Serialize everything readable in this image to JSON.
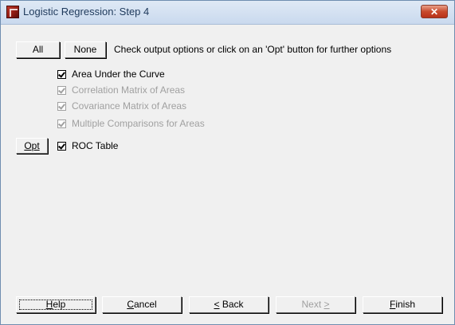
{
  "window": {
    "title": "Logistic Regression: Step 4"
  },
  "toolbar": {
    "all_label": "All",
    "none_label": "None",
    "hint": "Check output options or click on an 'Opt' button for further options"
  },
  "options": [
    {
      "label": "Area Under the Curve",
      "checked": true,
      "enabled": true
    },
    {
      "label": "Correlation Matrix of Areas",
      "checked": true,
      "enabled": false
    },
    {
      "label": "Covariance Matrix of Areas",
      "checked": true,
      "enabled": false
    },
    {
      "label": "Multiple Comparisons for Areas",
      "checked": true,
      "enabled": false
    },
    {
      "label": "ROC Table",
      "checked": true,
      "enabled": true,
      "opt_button": "Opt"
    }
  ],
  "footer": {
    "help": {
      "first": "H",
      "rest": "elp"
    },
    "cancel": {
      "first": "C",
      "rest": "ancel"
    },
    "back": {
      "first": "<",
      "rest": " Back"
    },
    "next": {
      "first": "Next ",
      "rest": ">"
    },
    "finish": {
      "first": "F",
      "rest": "inish"
    }
  },
  "colors": {
    "disabled_text": "#a0a0a0",
    "title_text": "#1e395b",
    "close_button": "#c84a2c"
  }
}
